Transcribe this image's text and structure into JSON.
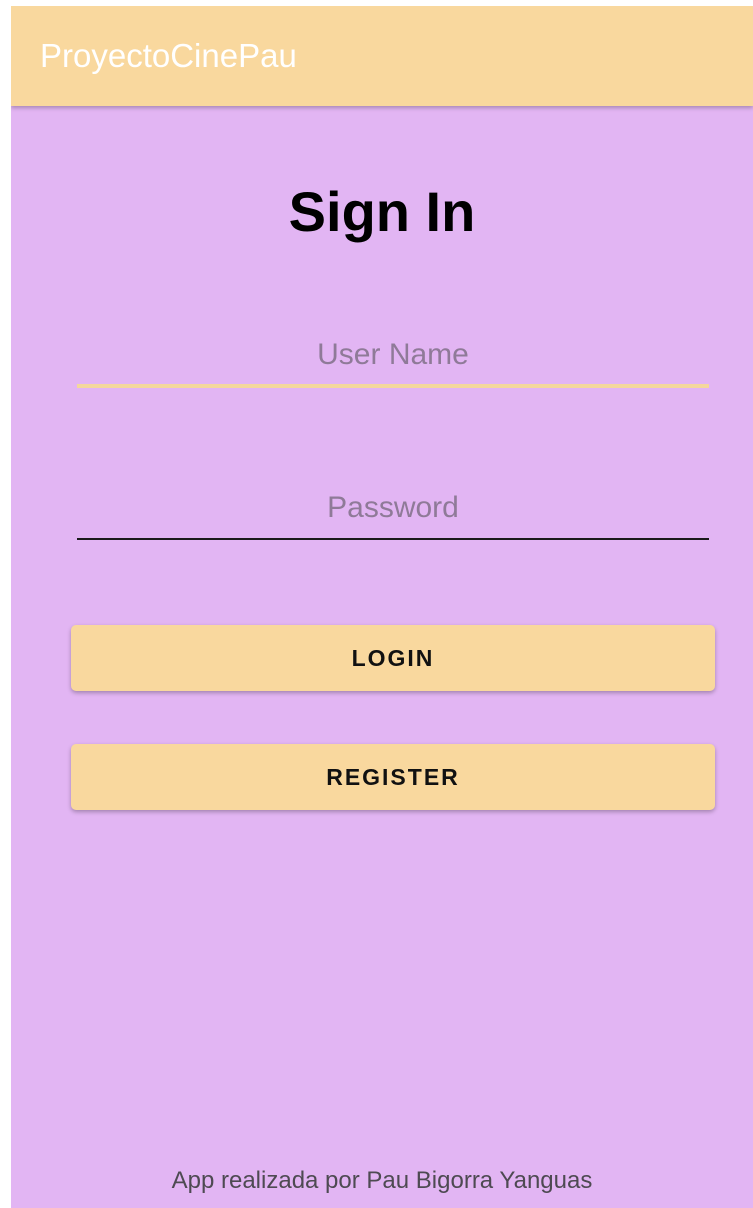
{
  "app_bar": {
    "title": "ProyectoCinePau"
  },
  "sign_in": {
    "heading": "Sign In",
    "username": {
      "value": "",
      "placeholder": "User Name"
    },
    "password": {
      "value": "",
      "placeholder": "Password"
    },
    "login_label": "LOGIN",
    "register_label": "REGISTER"
  },
  "footer": {
    "credit": "App realizada por Pau Bigorra Yanguas"
  },
  "colors": {
    "app_bar": "#f9d89e",
    "background": "#e2b5f3",
    "button": "#f9d89e",
    "focused_underline": "#f4d79c"
  }
}
